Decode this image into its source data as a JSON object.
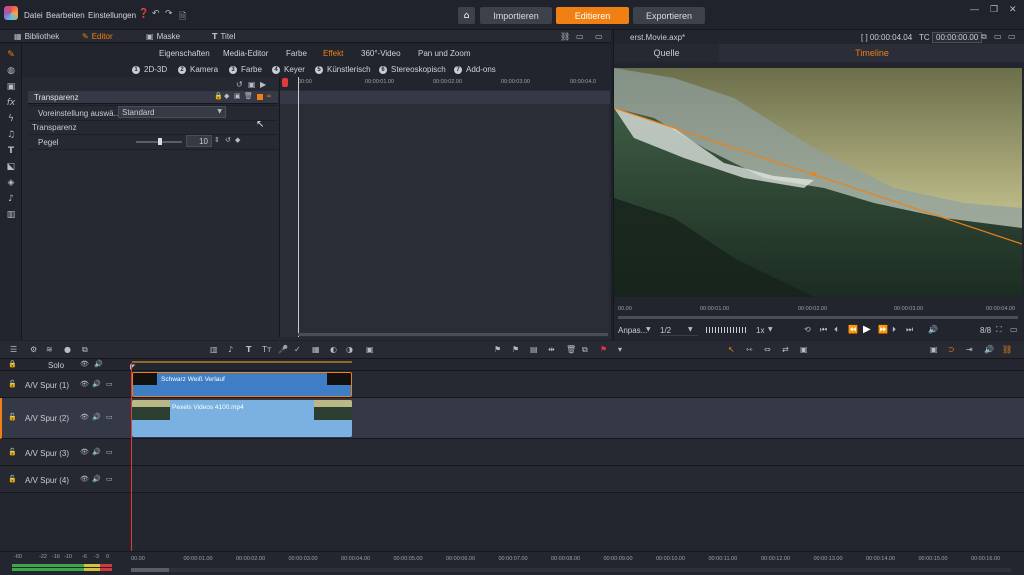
{
  "menu": [
    "Datei",
    "Bearbeiten",
    "Einstellungen"
  ],
  "nav": {
    "import": "Importieren",
    "edit": "Editieren",
    "export": "Exportieren"
  },
  "lib": {
    "library": "Bibliothek",
    "editor": "Editor",
    "mask": "Maske",
    "title": "Titel"
  },
  "prop_tabs": [
    "Eigenschaften",
    "Media-Editor",
    "Farbe",
    "Effekt",
    "360°-Video",
    "Pan und Zoom"
  ],
  "sub_tabs": [
    {
      "n": "1",
      "l": "2D-3D"
    },
    {
      "n": "2",
      "l": "Kamera"
    },
    {
      "n": "3",
      "l": "Farbe"
    },
    {
      "n": "4",
      "l": "Keyer"
    },
    {
      "n": "5",
      "l": "Künstlerisch"
    },
    {
      "n": "6",
      "l": "Stereoskopisch"
    },
    {
      "n": "7",
      "l": "Add-ons"
    }
  ],
  "props": {
    "header": "Transparenz",
    "preset_label": "Voreinstellung auswä...",
    "preset_value": "Standard",
    "group": "Transparenz",
    "level_label": "Pegel",
    "level_value": "10"
  },
  "kf_ticks": [
    "00:00",
    "00:00:01.00",
    "00:00:02.00",
    "00:00:03.00",
    "00:00:04.0"
  ],
  "preview": {
    "file": "erst.Movie.axp*",
    "tc1": "[ ] 00:00:04.04",
    "tc_label": "TC",
    "tc2": "00:00:00.00",
    "tab_source": "Quelle",
    "tab_timeline": "Timeline",
    "fit": "Anpas...",
    "ratio": "1/2",
    "speed": "1x",
    "bit": "8/8"
  },
  "pv_ticks": [
    "00.00",
    "00:00:01.00",
    "00:00:02.00",
    "00:00:03.00",
    "00:00:04.00"
  ],
  "timeline": {
    "solo": "Solo",
    "tracks": [
      "A/V Spur (1)",
      "A/V Spur (2)",
      "A/V Spur (3)",
      "A/V Spur (4)"
    ],
    "clip1": "Schwarz Weiß Verlauf",
    "clip2": "Pexels Videos 4100.mp4"
  },
  "tl_ticks": [
    "00.00",
    "00:00:01.00",
    "00:00:02.00",
    "00:00:03.00",
    "00:00:04.00",
    "00:00:05.00",
    "00:00:06.00",
    "00:00:07.00",
    "00:00:08.00",
    "00:00:09.00",
    "00:00:10.00",
    "00:00:11.00",
    "00:00:12.00",
    "00:00:13.00",
    "00:00:14.00",
    "00:00:15.00",
    "00:00:16.00"
  ],
  "meter": [
    "-60",
    "-22",
    "-16",
    "-10",
    "-6",
    "-3",
    "0"
  ],
  "colors": {
    "accent": "#f08014",
    "clip1": "#3f7ec4",
    "clip2": "#7bb1e0",
    "playhead": "#e03a3a"
  }
}
